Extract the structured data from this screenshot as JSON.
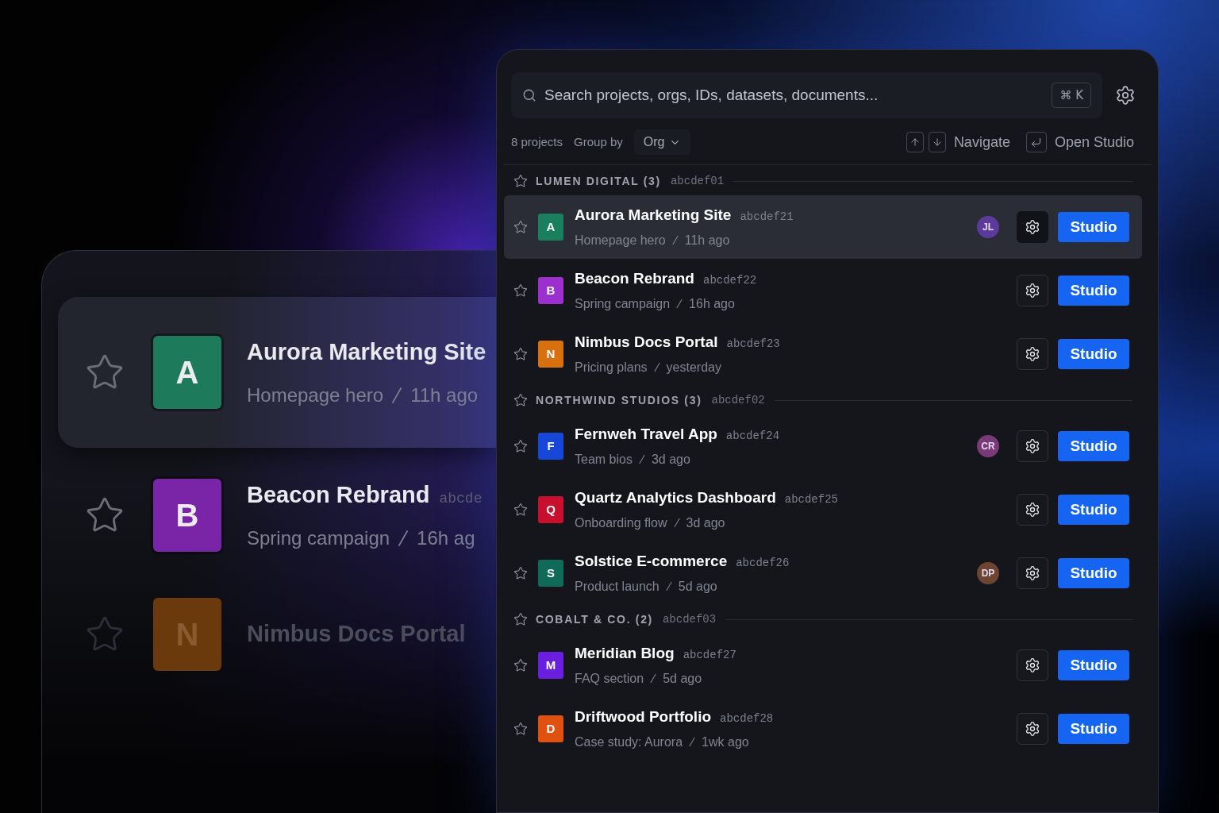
{
  "background_panel": {
    "rows": [
      {
        "initial": "A",
        "color": "#1d7a5b",
        "title": "Aurora Marketing Site",
        "subtitle": "Homepage hero",
        "time": "11h ago",
        "selected": true
      },
      {
        "initial": "B",
        "color": "#7a24a8",
        "title": "Beacon Rebrand",
        "id": "abcde",
        "subtitle": "Spring campaign",
        "time": "16h ag",
        "selected": false
      },
      {
        "initial": "N",
        "color": "#6a3a0c",
        "title": "Nimbus Docs Portal",
        "selected": false
      }
    ]
  },
  "search": {
    "placeholder": "Search projects, orgs, IDs, datasets, documents...",
    "shortcut": "⌘ K"
  },
  "toolbar": {
    "count": "8 projects",
    "group_by": {
      "label": "Group by",
      "value": "Org"
    },
    "hints": [
      {
        "kind": "arrows",
        "label": "Navigate"
      },
      {
        "kind": "enter",
        "label": "Open Studio"
      }
    ]
  },
  "groups": [
    {
      "name": "LUMEN DIGITAL (3)",
      "id": "abcdef01",
      "projects": [
        {
          "initial": "A",
          "color": "#1a7f5c",
          "title": "Aurora Marketing Site",
          "id": "abcdef21",
          "subtitle": "Homepage hero",
          "time": "11h ago",
          "selected": true,
          "avatar": {
            "initials": "JL",
            "color": "#5b3a9c"
          },
          "action": "Studio"
        },
        {
          "initial": "B",
          "color": "#9d2fcf",
          "title": "Beacon Rebrand",
          "id": "abcdef22",
          "subtitle": "Spring campaign",
          "time": "16h ago",
          "selected": false,
          "action": "Studio"
        },
        {
          "initial": "N",
          "color": "#d9700f",
          "title": "Nimbus Docs Portal",
          "id": "abcdef23",
          "subtitle": "Pricing plans",
          "time": "yesterday",
          "selected": false,
          "action": "Studio"
        }
      ]
    },
    {
      "name": "NORTHWIND STUDIOS (3)",
      "id": "abcdef02",
      "projects": [
        {
          "initial": "F",
          "color": "#1747d8",
          "title": "Fernweh Travel App",
          "id": "abcdef24",
          "subtitle": "Team bios",
          "time": "3d ago",
          "selected": false,
          "avatar": {
            "initials": "CR",
            "color": "#7a3a78"
          },
          "action": "Studio"
        },
        {
          "initial": "Q",
          "color": "#c8102e",
          "title": "Quartz Analytics Dashboard",
          "id": "abcdef25",
          "subtitle": "Onboarding flow",
          "time": "3d ago",
          "selected": false,
          "action": "Studio"
        },
        {
          "initial": "S",
          "color": "#0f6b58",
          "title": "Solstice E-commerce",
          "id": "abcdef26",
          "subtitle": "Product launch",
          "time": "5d ago",
          "selected": false,
          "avatar": {
            "initials": "DP",
            "color": "#6e4530"
          },
          "action": "Studio"
        }
      ]
    },
    {
      "name": "COBALT & CO. (2)",
      "id": "abcdef03",
      "projects": [
        {
          "initial": "M",
          "color": "#6a1fe0",
          "title": "Meridian Blog",
          "id": "abcdef27",
          "subtitle": "FAQ section",
          "time": "5d ago",
          "selected": false,
          "action": "Studio"
        },
        {
          "initial": "D",
          "color": "#e0500f",
          "title": "Driftwood Portfolio",
          "id": "abcdef28",
          "subtitle": "Case study: Aurora",
          "time": "1wk ago",
          "selected": false,
          "action": "Studio"
        }
      ]
    }
  ]
}
